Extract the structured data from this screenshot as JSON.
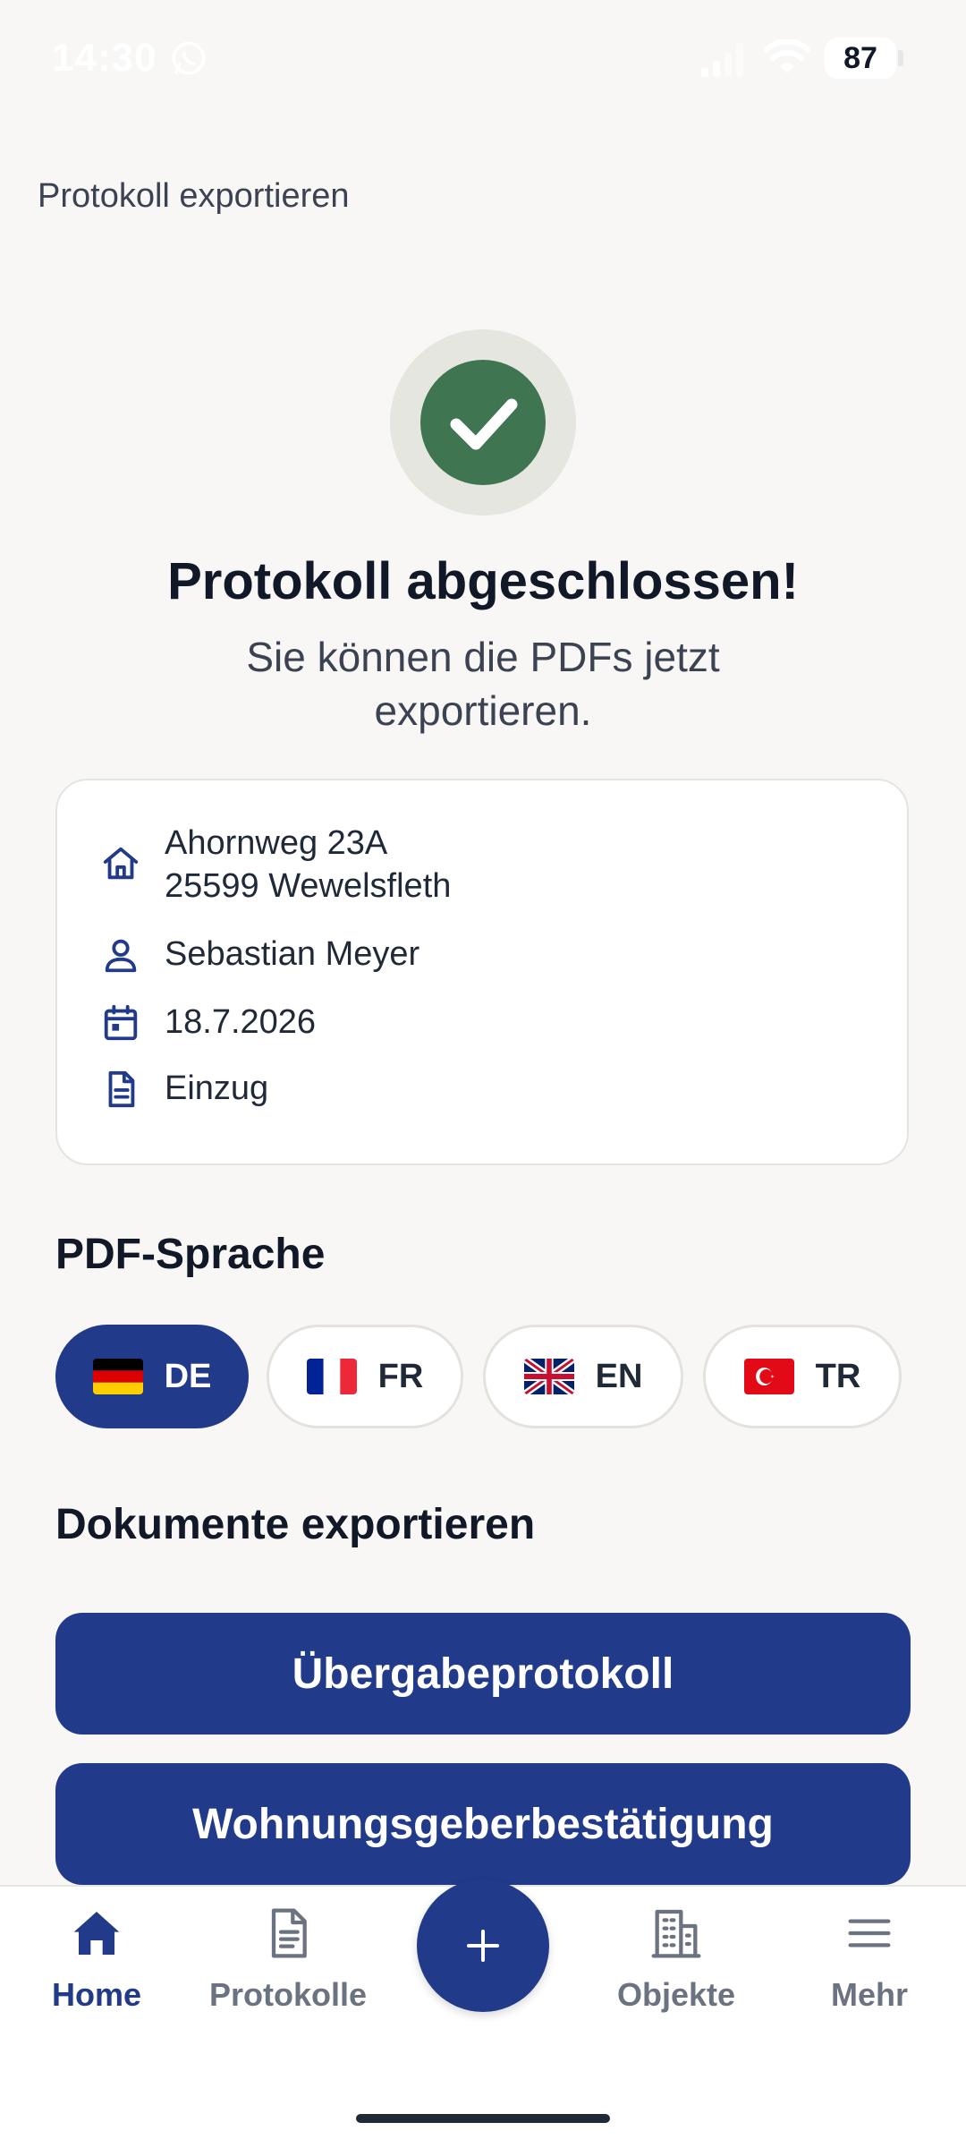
{
  "status_bar": {
    "time": "14:30",
    "battery": "87"
  },
  "header": {
    "title": "Protokoll exportieren"
  },
  "success": {
    "title": "Protokoll abgeschlossen!",
    "subtitle": "Sie können die PDFs jetzt exportieren."
  },
  "info": {
    "address_line1": "Ahornweg 23A",
    "address_line2": "25599 Wewelsfleth",
    "person": "Sebastian Meyer",
    "date": "18.7.2026",
    "type": "Einzug"
  },
  "pdf_language": {
    "title": "PDF-Sprache",
    "options": [
      {
        "code": "DE",
        "flag": "flag-de-icon",
        "selected": true
      },
      {
        "code": "FR",
        "flag": "flag-fr-icon",
        "selected": false
      },
      {
        "code": "EN",
        "flag": "flag-gb-icon",
        "selected": false
      },
      {
        "code": "TR",
        "flag": "flag-tr-icon",
        "selected": false
      }
    ]
  },
  "export": {
    "title": "Dokumente exportieren",
    "buttons": [
      "Übergabeprotokoll",
      "Wohnungsgeberbestätigung"
    ]
  },
  "nav": {
    "items": [
      {
        "label": "Home",
        "icon": "home-icon",
        "active": true
      },
      {
        "label": "Protokolle",
        "icon": "document-icon",
        "active": false
      },
      {
        "label": "Objekte",
        "icon": "building-icon",
        "active": false
      },
      {
        "label": "Mehr",
        "icon": "menu-icon",
        "active": false
      }
    ],
    "fab_icon": "plus-icon"
  },
  "colors": {
    "primary": "#213a8a",
    "success": "#3f7550",
    "background": "#f8f7f5"
  }
}
